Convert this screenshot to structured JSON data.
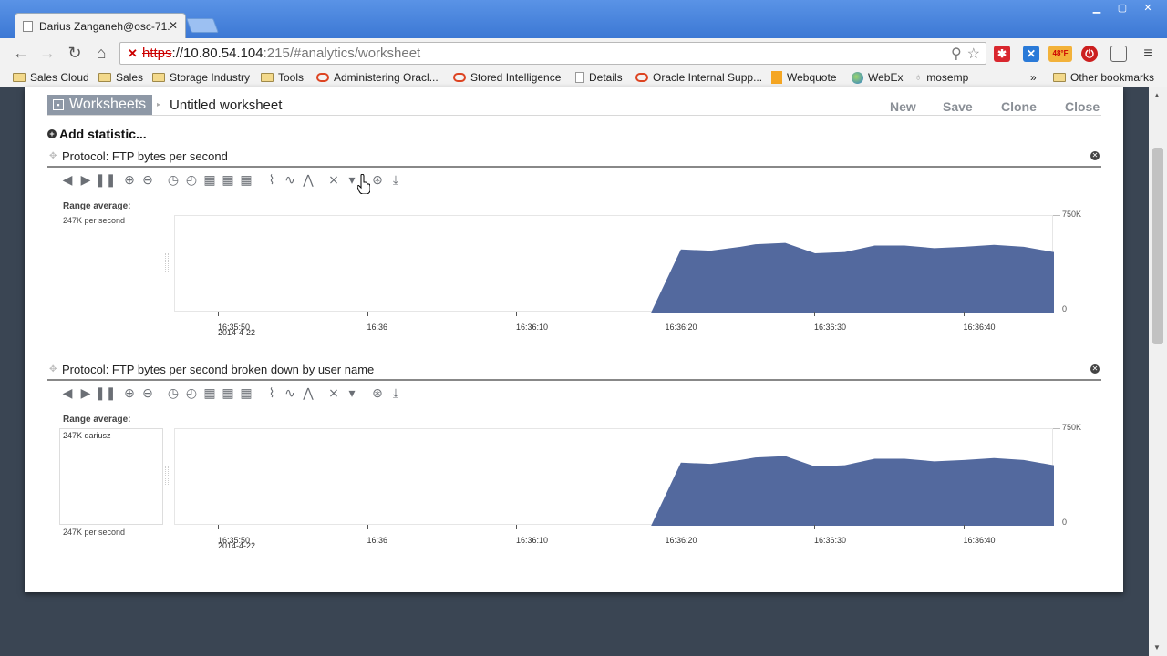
{
  "browser": {
    "tab_title": "Darius Zanganeh@osc-71.",
    "url_scheme": "https",
    "url_host": "://10.80.54.104",
    "url_rest": ":215/#analytics/worksheet",
    "bookmarks": [
      "Sales Cloud",
      "Sales",
      "Storage Industry",
      "Tools",
      "Administering Oracl...",
      "Stored Intelligence",
      "Details",
      "Oracle Internal Supp...",
      "Webquote",
      "WebEx",
      "mosemp"
    ],
    "overflow": "»",
    "other_bookmarks": "Other bookmarks",
    "weather": "48°F"
  },
  "worksheet": {
    "tab_label": "Worksheets",
    "title": "Untitled worksheet",
    "actions": [
      "New",
      "Save",
      "Clone",
      "Close"
    ],
    "add_statistic": "Add statistic..."
  },
  "stats": [
    {
      "title": "Protocol: FTP bytes per second",
      "range_label": "Range average:",
      "range_value": "247K per second"
    },
    {
      "title": "Protocol: FTP bytes per second broken down by user name",
      "range_label": "Range average:",
      "user_entry": "247K dariusz",
      "range_value": "247K per second"
    }
  ],
  "chart_data": [
    {
      "type": "area",
      "ylim": [
        0,
        750
      ],
      "ytick_labels": [
        "750K",
        "0"
      ],
      "xtick_labels": [
        "16:35:50",
        "16:36",
        "16:36:10",
        "16:36:20",
        "16:36:30",
        "16:36:40"
      ],
      "date_label": "2014-4-22",
      "color": "#53699e",
      "x": [
        0,
        26,
        29,
        31,
        33,
        35,
        36,
        38,
        40,
        42,
        44,
        46,
        48,
        50,
        52,
        54,
        56,
        58,
        60,
        62,
        64,
        66,
        68,
        70,
        72,
        74,
        75,
        77,
        78,
        79.5
      ],
      "y": [
        0,
        0,
        0,
        490,
        480,
        510,
        530,
        540,
        460,
        470,
        520,
        520,
        500,
        510,
        525,
        510,
        470,
        510,
        470,
        490,
        540,
        520,
        480,
        500,
        540,
        505,
        490,
        430,
        250,
        200
      ]
    },
    {
      "type": "area",
      "ylim": [
        0,
        750
      ],
      "ytick_labels": [
        "750K",
        "0"
      ],
      "xtick_labels": [
        "16:35:50",
        "16:36",
        "16:36:10",
        "16:36:20",
        "16:36:30",
        "16:36:40"
      ],
      "date_label": "2014-4-22",
      "color": "#53699e",
      "x": [
        0,
        26,
        29,
        31,
        33,
        35,
        36,
        38,
        40,
        42,
        44,
        46,
        48,
        50,
        52,
        54,
        56,
        58,
        60,
        62,
        64,
        66,
        68,
        70,
        72,
        74,
        75,
        77,
        78,
        79.5
      ],
      "y": [
        0,
        0,
        0,
        490,
        480,
        510,
        530,
        540,
        460,
        470,
        520,
        520,
        500,
        510,
        525,
        510,
        470,
        510,
        470,
        490,
        540,
        520,
        480,
        500,
        540,
        505,
        490,
        430,
        250,
        200
      ]
    }
  ]
}
